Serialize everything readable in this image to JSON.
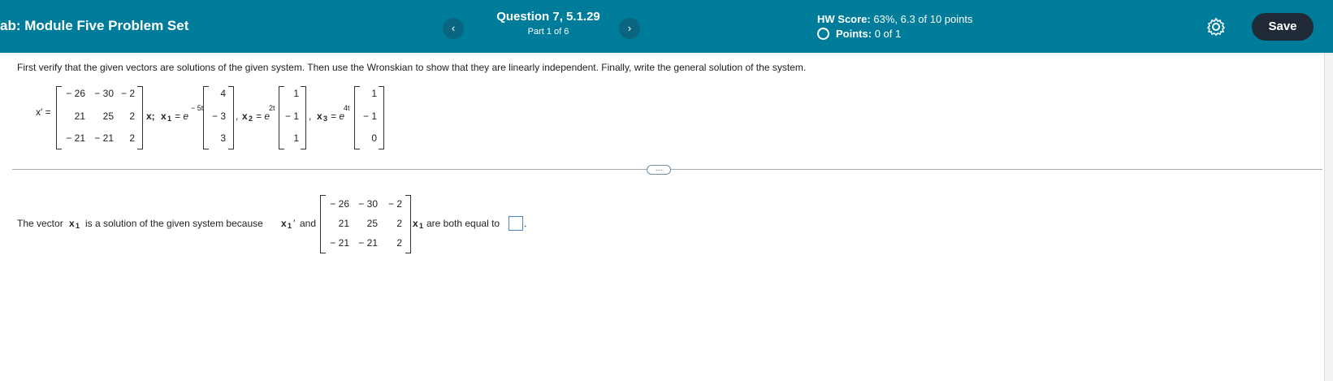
{
  "header": {
    "title": "ab: Module Five Problem Set",
    "prev_icon": "‹",
    "next_icon": "›",
    "question_title": "Question 7, 5.1.29",
    "question_part": "Part 1 of 6",
    "hw_score_label": "HW Score:",
    "hw_score_value": "63%, 6.3 of 10 points",
    "points_label": "Points:",
    "points_value": "0 of 1",
    "save_label": "Save",
    "settings_icon": "gear-icon"
  },
  "problem": {
    "instructions": "First verify that the given vectors are solutions of the given system. Then use the Wronskian to show that they are linearly independent. Finally, write the general solution of the system.",
    "xprime_label": "x′ =",
    "matrix": [
      [
        "− 26",
        "− 30",
        "− 2"
      ],
      [
        "21",
        "25",
        "2"
      ],
      [
        "− 21",
        "− 21",
        "2"
      ]
    ],
    "x_after_matrix": "x;",
    "x1_label": "x",
    "x1_sub": "1",
    "x1_eq": "= e",
    "x1_exp": "− 5t",
    "x1_vec": [
      "4",
      "− 3",
      "3"
    ],
    "x2_label": "x",
    "x2_sub": "2",
    "x2_eq": "= e",
    "x2_exp": "2t",
    "x2_vec": [
      "1",
      "− 1",
      "1"
    ],
    "x3_label": "x",
    "x3_sub": "3",
    "x3_eq": "= e",
    "x3_exp": "4t",
    "x3_vec": [
      "1",
      "− 1",
      "0"
    ],
    "comma": ","
  },
  "more_button": "…",
  "answer": {
    "text_before": "The vector",
    "x_label": "x",
    "x_sub": "1",
    "text_middle": "is a solution of the given system because",
    "x1prime": "x",
    "x1prime_sub": "1",
    "prime": "′",
    "and": "and",
    "text_after": "are both equal to",
    "period": "."
  }
}
